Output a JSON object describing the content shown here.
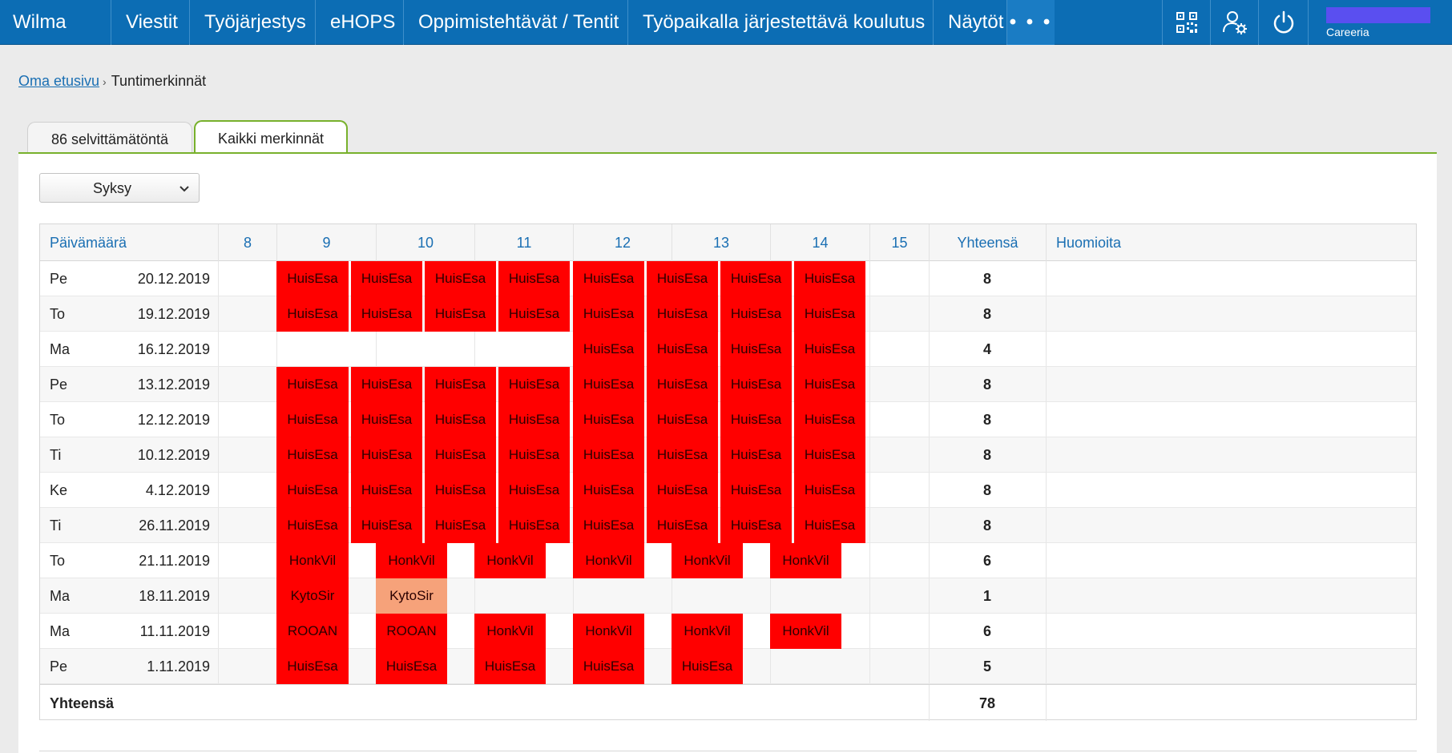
{
  "nav": {
    "brand": "Wilma",
    "items": [
      "Viestit",
      "Työjärjestys",
      "eHOPS",
      "Oppimistehtävät / Tentit",
      "Työpaikalla järjestettävä koulutus",
      "Näytöt"
    ],
    "more": "• • •",
    "icons": [
      "qr-code-icon",
      "user-settings-icon",
      "power-icon"
    ],
    "organization": "Careeria"
  },
  "breadcrumb": {
    "home": "Oma etusivu",
    "current": "Tuntimerkinnät"
  },
  "tabs": [
    {
      "label": "86 selvittämätöntä",
      "active": false
    },
    {
      "label": "Kaikki merkinnät",
      "active": true
    }
  ],
  "term_select": {
    "value": "Syksy"
  },
  "colors": {
    "absence_red": "#ff0000",
    "absence_light": "#f6a27a",
    "nav_blue": "#0c6db4",
    "tab_green": "#78b12c",
    "link_blue": "#1a6fb3"
  },
  "table": {
    "headers": {
      "date": "Päivämäärä",
      "hours": [
        "8",
        "9",
        "10",
        "11",
        "12",
        "13",
        "14",
        "15"
      ],
      "total": "Yhteensä",
      "notes": "Huomioita"
    },
    "rows": [
      {
        "day": "Pe",
        "date": "20.12.2019",
        "total": "8"
      },
      {
        "day": "To",
        "date": "19.12.2019",
        "total": "8"
      },
      {
        "day": "Ma",
        "date": "16.12.2019",
        "total": "4"
      },
      {
        "day": "Pe",
        "date": "13.12.2019",
        "total": "8"
      },
      {
        "day": "To",
        "date": "12.12.2019",
        "total": "8"
      },
      {
        "day": "Ti",
        "date": "10.12.2019",
        "total": "8"
      },
      {
        "day": "Ke",
        "date": "4.12.2019",
        "total": "8"
      },
      {
        "day": "Ti",
        "date": "26.11.2019",
        "total": "8"
      },
      {
        "day": "To",
        "date": "21.11.2019",
        "total": "6"
      },
      {
        "day": "Ma",
        "date": "18.11.2019",
        "total": "1"
      },
      {
        "day": "Ma",
        "date": "11.11.2019",
        "total": "6"
      },
      {
        "day": "Pe",
        "date": "1.11.2019",
        "total": "5"
      }
    ],
    "marks": [
      [
        "HuisEsa",
        "HuisEsa",
        "HuisEsa",
        "HuisEsa",
        "HuisEsa",
        "HuisEsa",
        "HuisEsa",
        "HuisEsa"
      ],
      [
        "HuisEsa",
        "HuisEsa",
        "HuisEsa",
        "HuisEsa",
        "HuisEsa",
        "HuisEsa",
        "HuisEsa",
        "HuisEsa"
      ],
      [
        "HuisEsa",
        "HuisEsa",
        "HuisEsa",
        "HuisEsa"
      ],
      [
        "HuisEsa",
        "HuisEsa",
        "HuisEsa",
        "HuisEsa",
        "HuisEsa",
        "HuisEsa",
        "HuisEsa",
        "HuisEsa"
      ],
      [
        "HuisEsa",
        "HuisEsa",
        "HuisEsa",
        "HuisEsa",
        "HuisEsa",
        "HuisEsa",
        "HuisEsa",
        "HuisEsa"
      ],
      [
        "HuisEsa",
        "HuisEsa",
        "HuisEsa",
        "HuisEsa",
        "HuisEsa",
        "HuisEsa",
        "HuisEsa",
        "HuisEsa"
      ],
      [
        "HuisEsa",
        "HuisEsa",
        "HuisEsa",
        "HuisEsa",
        "HuisEsa",
        "HuisEsa",
        "HuisEsa",
        "HuisEsa"
      ],
      [
        "HuisEsa",
        "HuisEsa",
        "HuisEsa",
        "HuisEsa",
        "HuisEsa",
        "HuisEsa",
        "HuisEsa",
        "HuisEsa"
      ],
      [
        "HonkVil",
        "HonkVil",
        "HonkVil",
        "HonkVil",
        "HonkVil",
        "HonkVil"
      ],
      [
        "KytoSir",
        "KytoSir"
      ],
      [
        "ROOAN",
        "ROOAN",
        "HonkVil",
        "HonkVil",
        "HonkVil",
        "HonkVil"
      ],
      [
        "HuisEsa",
        "HuisEsa",
        "HuisEsa",
        "HuisEsa",
        "HuisEsa"
      ]
    ],
    "footer": {
      "label": "Yhteensä",
      "total": "78"
    }
  }
}
